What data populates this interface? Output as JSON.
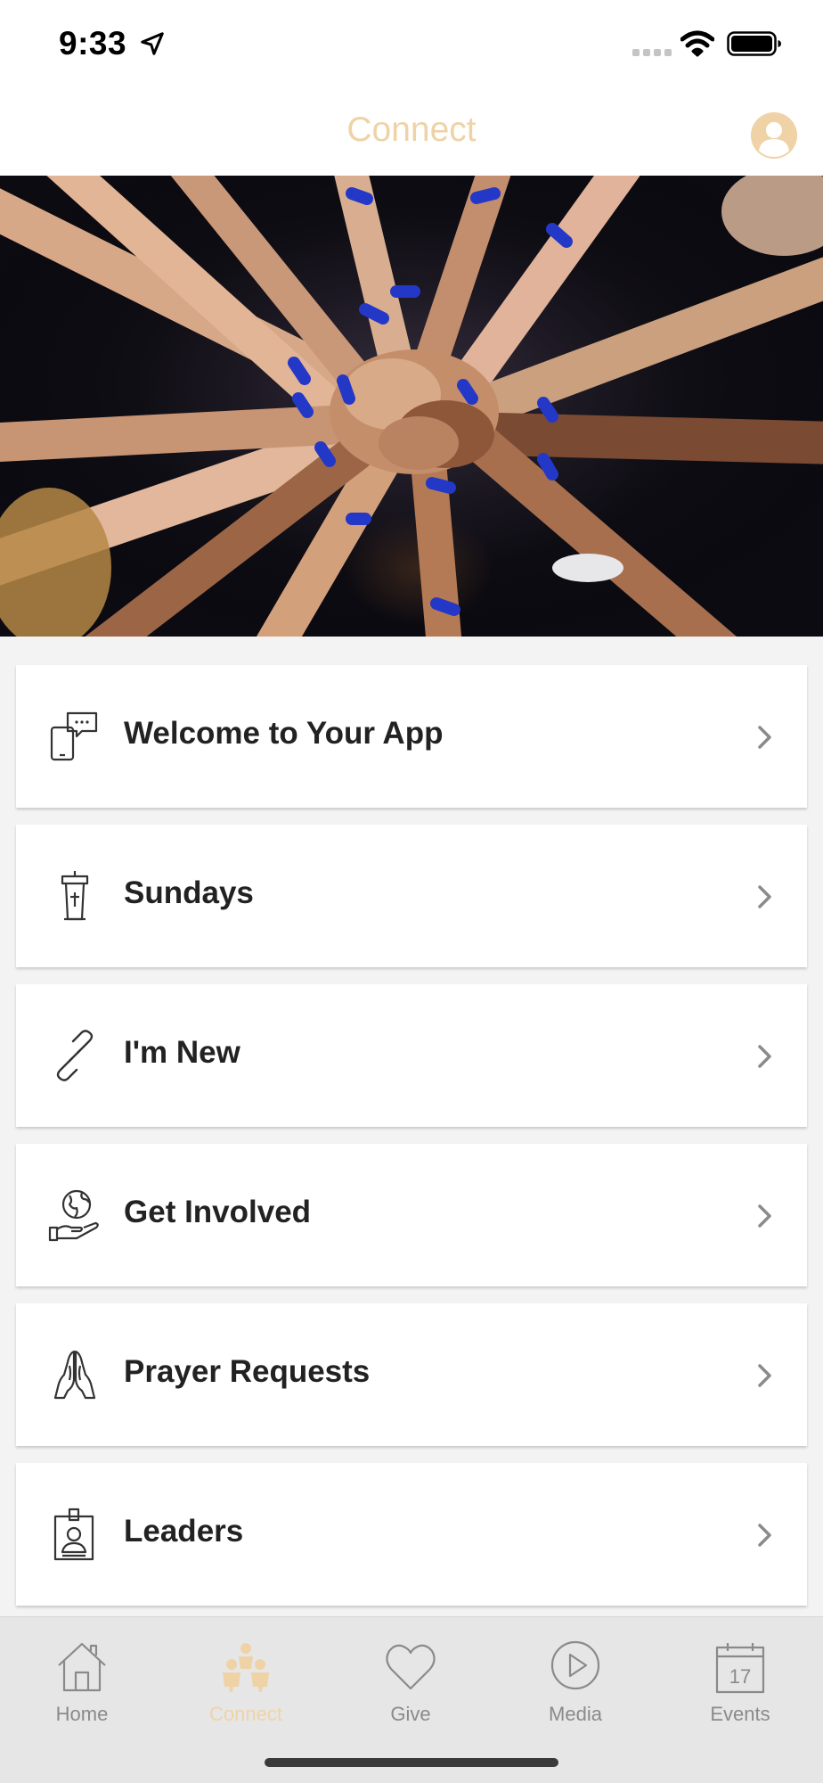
{
  "status_bar": {
    "time": "9:33"
  },
  "nav": {
    "title": "Connect"
  },
  "menu": [
    {
      "label": "Welcome to Your App",
      "icon": "phone-chat-icon"
    },
    {
      "label": "Sundays",
      "icon": "pulpit-icon"
    },
    {
      "label": "I'm New",
      "icon": "link-icon"
    },
    {
      "label": "Get Involved",
      "icon": "globe-hand-icon"
    },
    {
      "label": "Prayer Requests",
      "icon": "praying-hands-icon"
    },
    {
      "label": "Leaders",
      "icon": "id-badge-icon"
    }
  ],
  "tabs": [
    {
      "label": "Home",
      "icon": "home-icon",
      "active": false
    },
    {
      "label": "Connect",
      "icon": "people-icon",
      "active": true
    },
    {
      "label": "Give",
      "icon": "heart-icon",
      "active": false
    },
    {
      "label": "Media",
      "icon": "play-icon",
      "active": false
    },
    {
      "label": "Events",
      "icon": "calendar-icon",
      "active": false
    }
  ],
  "events_calendar_day": "17",
  "colors": {
    "accent": "#efd3a6",
    "tab_inactive": "#8a8a8a",
    "wristband_blue": "#2438c8"
  }
}
